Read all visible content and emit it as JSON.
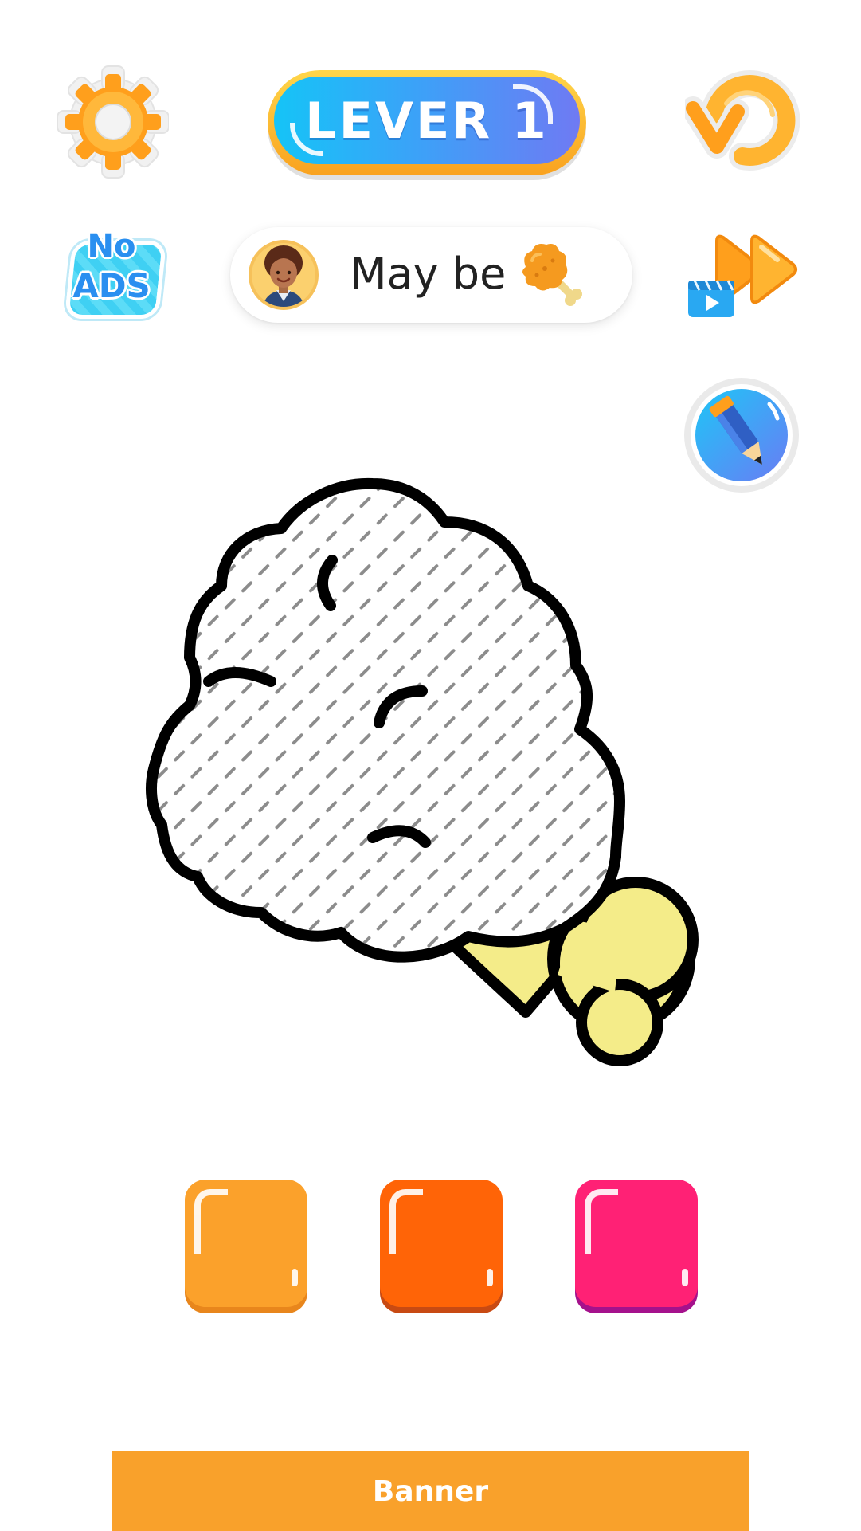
{
  "header": {
    "level_label": "LEVER 1"
  },
  "hint": {
    "text": "May be"
  },
  "no_ads": {
    "line1": "No",
    "line2": "ADS"
  },
  "icons": {
    "settings": "gear-icon",
    "undo": "undo-check-icon",
    "skip": "video-fast-forward-icon",
    "pencil": "pencil-icon",
    "avatar": "girl-avatar-icon",
    "hint_item": "chicken-drumstick-icon"
  },
  "palette": [
    {
      "color": "#fba12b",
      "shade": "#e8861c"
    },
    {
      "color": "#ff6407",
      "shade": "#c84a13"
    },
    {
      "color": "#ff2175",
      "shade": "#a5118c"
    }
  ],
  "drawing": {
    "subject": "chicken drumstick",
    "bone_color": "#f4ec89",
    "outline_color": "#000000"
  },
  "banner": {
    "label": "Banner",
    "color": "#f9a12b"
  }
}
